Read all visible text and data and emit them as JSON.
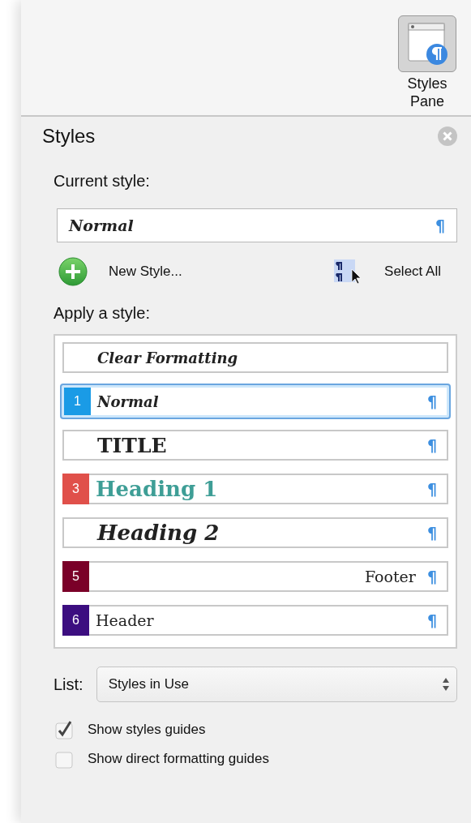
{
  "toolbar": {
    "styles_pane_button": {
      "label": "Styles Pane",
      "selected": true
    }
  },
  "panel": {
    "title": "Styles",
    "current_style": {
      "label": "Current style:",
      "value": "Normal",
      "mark": "¶"
    },
    "actions": [
      {
        "kind": "new",
        "label": "New Style..."
      },
      {
        "kind": "select",
        "label": "Select All"
      }
    ],
    "apply_label": "Apply a style:",
    "styles": [
      {
        "kind": "clear",
        "name": "Clear Formatting",
        "selected": false
      },
      {
        "kind": "normal",
        "badge": "1",
        "color": "#1a9be6",
        "name": "Normal",
        "mark": "¶",
        "selected": true
      },
      {
        "kind": "title",
        "name": "TITLE",
        "mark": "¶",
        "selected": false
      },
      {
        "kind": "heading1",
        "badge": "3",
        "color": "#e0504a",
        "name": "Heading 1",
        "mark": "¶",
        "selected": false
      },
      {
        "kind": "heading2",
        "name": "Heading 2",
        "mark": "¶",
        "selected": false
      },
      {
        "kind": "footer",
        "badge": "5",
        "color": "#7a0028",
        "name": "Footer",
        "mark": "¶",
        "selected": false
      },
      {
        "kind": "header",
        "badge": "6",
        "color": "#3c0e80",
        "name": "Header",
        "mark": "¶",
        "selected": false
      }
    ],
    "list": {
      "label": "List:",
      "value": "Styles in Use"
    },
    "options": [
      {
        "label": "Show styles guides",
        "checked": true
      },
      {
        "label": "Show direct formatting guides",
        "checked": false
      }
    ]
  }
}
